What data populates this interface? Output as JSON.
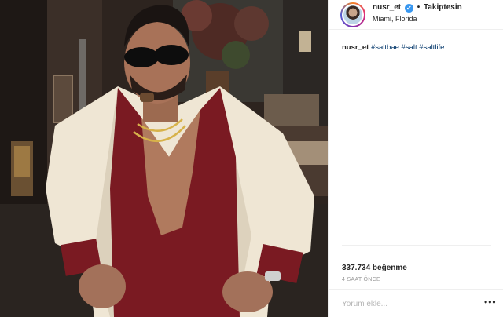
{
  "post": {
    "username": "nusr_et",
    "follow_status": "Takiptesin",
    "separator": "•",
    "location": "Miami, Florida",
    "caption": {
      "user": "nusr_et",
      "tags": [
        "#saltbae",
        "#salt",
        "#saltlife"
      ]
    },
    "likes": "337.734 beğenme",
    "time": "4 SAAT ÖNCE",
    "comment_placeholder": "Yorum ekle...",
    "more_label": "•••",
    "verified_glyph": "✔"
  },
  "colors": {
    "link": "#003569",
    "verified": "#3897f0",
    "jacket": "#efe6d4",
    "shirt": "#7a1a22"
  },
  "icons": {
    "verified": "verified-badge-icon",
    "more": "more-options-icon"
  }
}
